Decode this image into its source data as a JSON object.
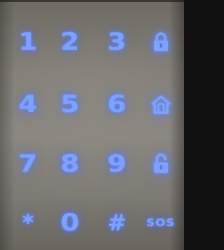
{
  "keypad": {
    "keys": [
      {
        "label": "1"
      },
      {
        "label": "2"
      },
      {
        "label": "3"
      },
      {
        "icon": "locked-padlock-icon"
      },
      {
        "label": "4"
      },
      {
        "label": "5"
      },
      {
        "label": "6"
      },
      {
        "icon": "home-icon"
      },
      {
        "label": "7"
      },
      {
        "label": "8"
      },
      {
        "label": "9"
      },
      {
        "icon": "unlocked-padlock-icon"
      },
      {
        "label": "*"
      },
      {
        "label": "0"
      },
      {
        "label": "#"
      },
      {
        "label": "SOS"
      }
    ],
    "glow_color": "#7ea0ff",
    "background_color": "#85817a"
  }
}
